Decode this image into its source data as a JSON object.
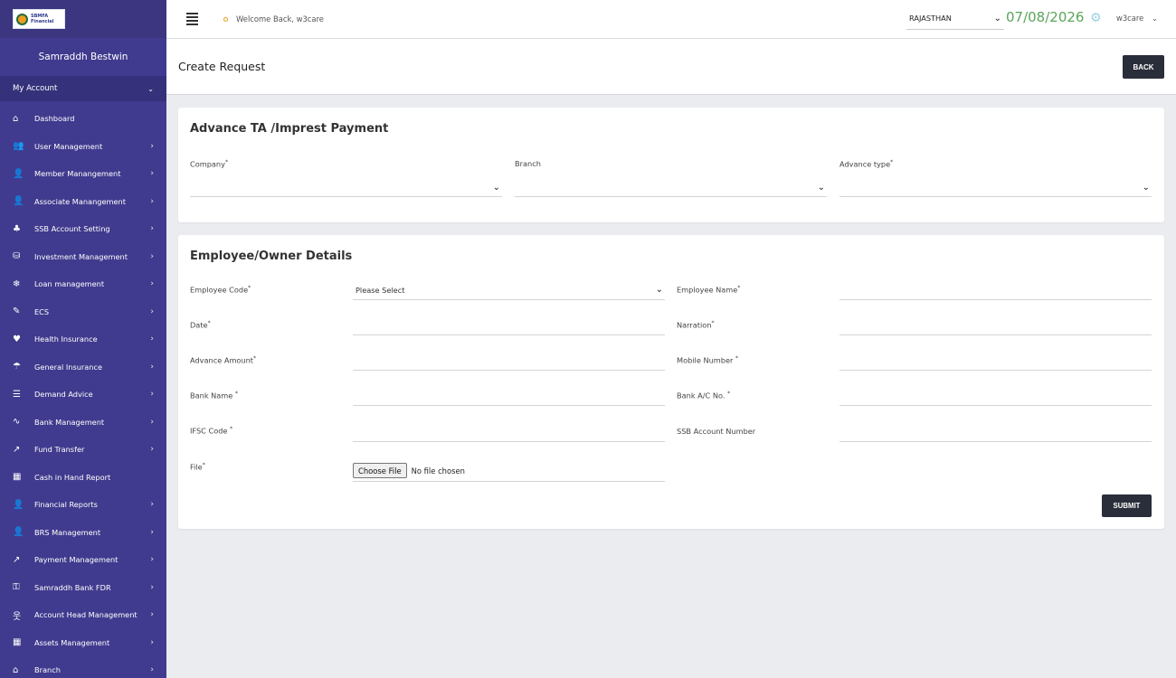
{
  "sidebar": {
    "logo_text_1": "SBMFA",
    "logo_text_2": "Financial",
    "brand": "Samraddh Bestwin",
    "account_label": "My Account",
    "items": [
      {
        "label": "Dashboard",
        "icon": "home-icon",
        "glyph": "⌂",
        "has_arrow": false
      },
      {
        "label": "User Management",
        "icon": "users-icon",
        "glyph": "👥",
        "has_arrow": true
      },
      {
        "label": "Member Manangement",
        "icon": "user-icon",
        "glyph": "👤",
        "has_arrow": true
      },
      {
        "label": "Associate Manangement",
        "icon": "user-tie-icon",
        "glyph": "👤",
        "has_arrow": true
      },
      {
        "label": "SSB Account Setting",
        "icon": "piggy-bank-icon",
        "glyph": "♣",
        "has_arrow": true
      },
      {
        "label": "Investment Management",
        "icon": "coins-icon",
        "glyph": "⛁",
        "has_arrow": true
      },
      {
        "label": "Loan management",
        "icon": "snowflake-icon",
        "glyph": "❄",
        "has_arrow": true
      },
      {
        "label": "ECS",
        "icon": "edit-icon",
        "glyph": "✎",
        "has_arrow": true
      },
      {
        "label": "Health Insurance",
        "icon": "heart-icon",
        "glyph": "♥",
        "has_arrow": true
      },
      {
        "label": "General Insurance",
        "icon": "hand-holding-icon",
        "glyph": "☂",
        "has_arrow": true
      },
      {
        "label": "Demand Advice",
        "icon": "list-icon",
        "glyph": "☰",
        "has_arrow": true
      },
      {
        "label": "Bank Management",
        "icon": "pulse-icon",
        "glyph": "∿",
        "has_arrow": true
      },
      {
        "label": "Fund Transfer",
        "icon": "share-icon",
        "glyph": "↗",
        "has_arrow": true
      },
      {
        "label": "Cash in Hand Report",
        "icon": "cash-register-icon",
        "glyph": "▦",
        "has_arrow": false
      },
      {
        "label": "Financial Reports",
        "icon": "user-icon",
        "glyph": "👤",
        "has_arrow": true
      },
      {
        "label": "BRS Management",
        "icon": "user-icon",
        "glyph": "👤",
        "has_arrow": true
      },
      {
        "label": "Payment Management",
        "icon": "share-icon",
        "glyph": "↗",
        "has_arrow": true
      },
      {
        "label": "Samraddh Bank FDR",
        "icon": "key-icon",
        "glyph": "⚿",
        "has_arrow": true
      },
      {
        "label": "Account Head Management",
        "icon": "person-arms-icon",
        "glyph": "웃",
        "has_arrow": true
      },
      {
        "label": "Assets Management",
        "icon": "table-icon",
        "glyph": "▦",
        "has_arrow": true
      },
      {
        "label": "Branch",
        "icon": "home-icon",
        "glyph": "⌂",
        "has_arrow": true
      }
    ]
  },
  "topbar": {
    "welcome": "Welcome Back, w3care",
    "state": "RAJASTHAN",
    "date": "07/08/2026",
    "user": "w3care"
  },
  "page": {
    "title": "Create Request",
    "back_label": "BACK"
  },
  "advance_card": {
    "title": "Advance TA /Imprest Payment",
    "company_label": "Company",
    "branch_label": "Branch",
    "advance_type_label": "Advance type"
  },
  "employee_card": {
    "title": "Employee/Owner Details",
    "employee_code_label": "Employee Code",
    "employee_code_value": "Please Select",
    "employee_name_label": "Employee Name",
    "date_label": "Date",
    "narration_label": "Narration",
    "advance_amount_label": "Advance Amount",
    "mobile_number_label": "Mobile Number",
    "bank_name_label": "Bank Name",
    "bank_ac_label": "Bank A/C No.",
    "ifsc_label": "IFSC Code",
    "ssb_label": "SSB Account Number",
    "file_label": "File",
    "choose_file": "Choose File",
    "file_status": "No file chosen",
    "submit_label": "SUBMIT"
  },
  "required_mark": "*",
  "colors": {
    "sidebar_bg": "#403b8e",
    "button_dark": "#2a2e3a",
    "date_green": "#5aa55a",
    "page_bg": "#ebecef"
  }
}
